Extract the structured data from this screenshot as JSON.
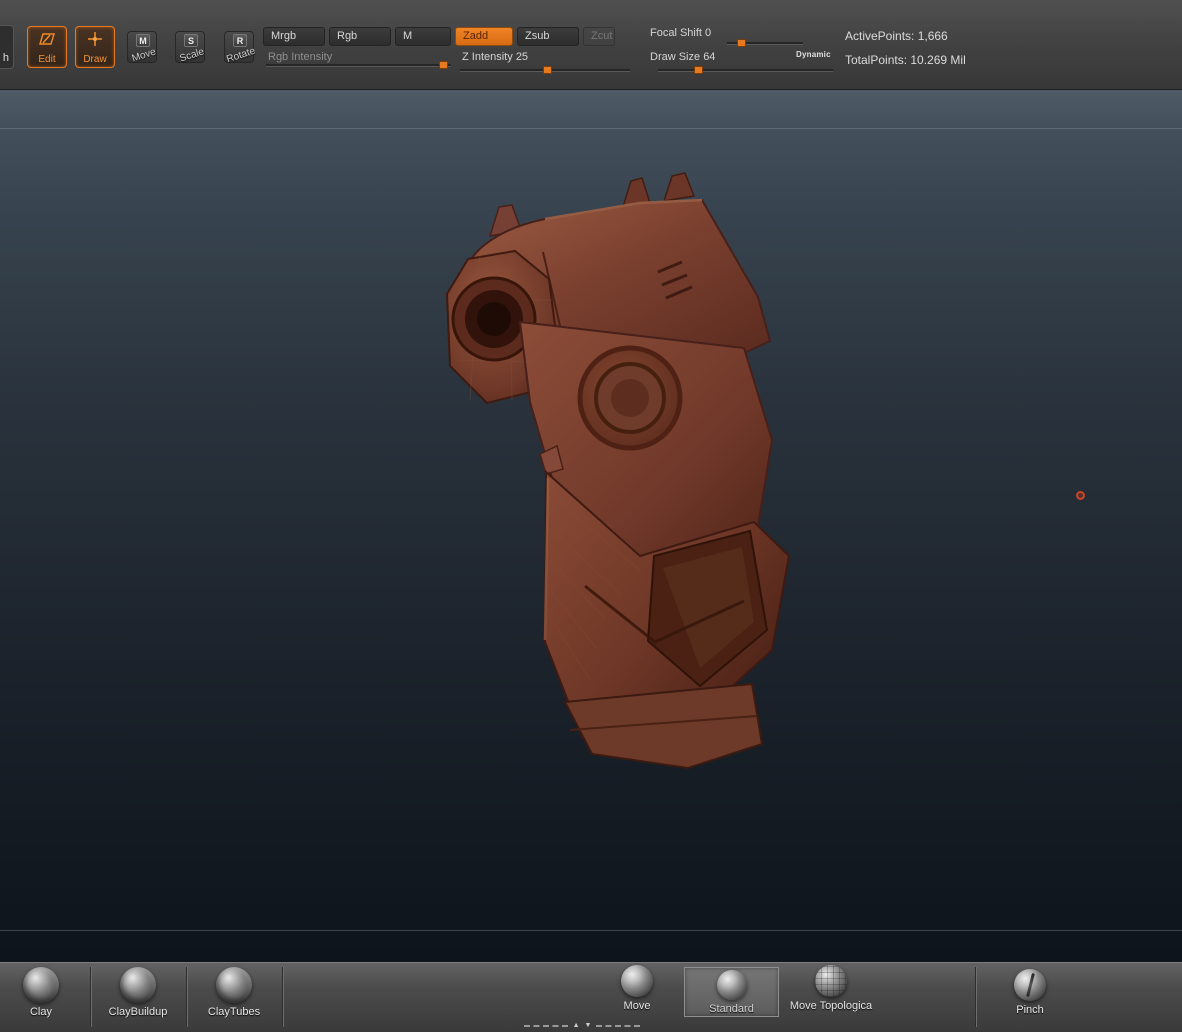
{
  "topbar": {
    "partial_button": "h",
    "edit_label": "Edit",
    "draw_label": "Draw",
    "move_label": "Move",
    "scale_label": "Scale",
    "rotate_label": "Rotate",
    "move_icon": "M",
    "scale_icon": "S",
    "rotate_icon": "R",
    "mrgb_label": "Mrgb",
    "rgb_label": "Rgb",
    "m_label": "M",
    "zadd_label": "Zadd",
    "zsub_label": "Zsub",
    "zcut_label": "Zcut",
    "rgb_intensity_label": "Rgb Intensity",
    "z_intensity_label": "Z Intensity",
    "z_intensity_value": "25",
    "focal_shift_label": "Focal Shift",
    "focal_shift_value": "0",
    "draw_size_label": "Draw Size",
    "draw_size_value": "64",
    "dynamic_label": "Dynamic",
    "active_points": "ActivePoints: 1,666",
    "total_points": "TotalPoints: 10.269 Mil"
  },
  "colors": {
    "accent_orange": "#e8791e",
    "model_base": "#7c4130",
    "canvas_top": "#4e5b67",
    "canvas_bottom": "#0e141b"
  },
  "bottombar": {
    "brushes": [
      {
        "label": "Clay"
      },
      {
        "label": "ClayBuildup"
      },
      {
        "label": "ClayTubes"
      },
      {
        "label": "Move"
      },
      {
        "label": "Standard"
      },
      {
        "label": "Move Topologica"
      },
      {
        "label": "Pinch"
      }
    ]
  }
}
